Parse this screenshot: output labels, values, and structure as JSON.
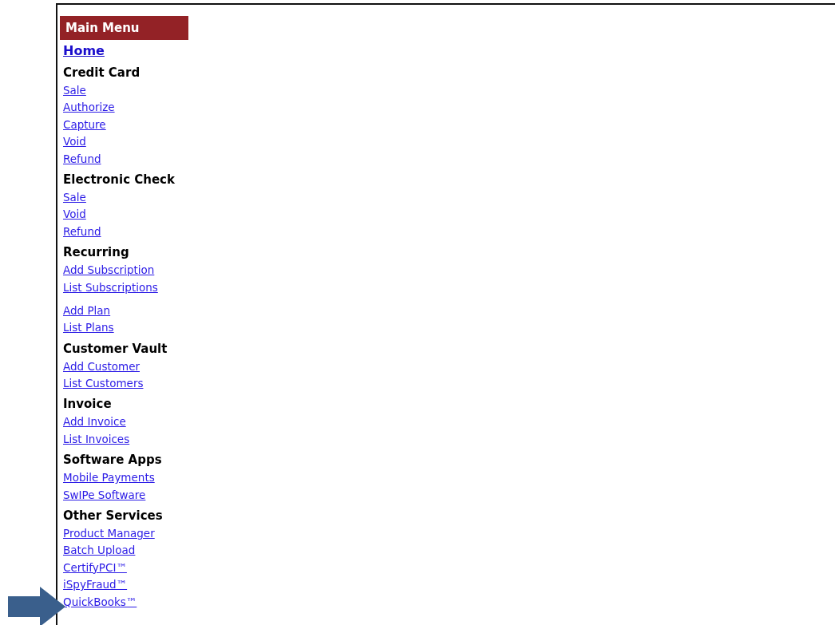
{
  "menu": {
    "title": "Main Menu",
    "home": "Home",
    "sections": [
      {
        "heading": "Credit Card",
        "groups": [
          [
            "Sale",
            "Authorize",
            "Capture",
            "Void",
            "Refund"
          ]
        ]
      },
      {
        "heading": "Electronic Check",
        "groups": [
          [
            "Sale",
            "Void",
            "Refund"
          ]
        ]
      },
      {
        "heading": "Recurring",
        "groups": [
          [
            "Add Subscription",
            "List Subscriptions"
          ],
          [
            "Add Plan",
            "List Plans"
          ]
        ]
      },
      {
        "heading": "Customer Vault",
        "groups": [
          [
            "Add Customer",
            "List Customers"
          ]
        ]
      },
      {
        "heading": "Invoice",
        "groups": [
          [
            "Add Invoice",
            "List Invoices"
          ]
        ]
      },
      {
        "heading": "Software Apps",
        "groups": [
          [
            "Mobile Payments",
            "SwIPe Software"
          ]
        ]
      },
      {
        "heading": "Other Services",
        "groups": [
          [
            "Product Manager",
            "Batch Upload",
            "CertifyPCI™",
            "iSpyFraud™",
            "QuickBooks™"
          ]
        ]
      }
    ]
  }
}
